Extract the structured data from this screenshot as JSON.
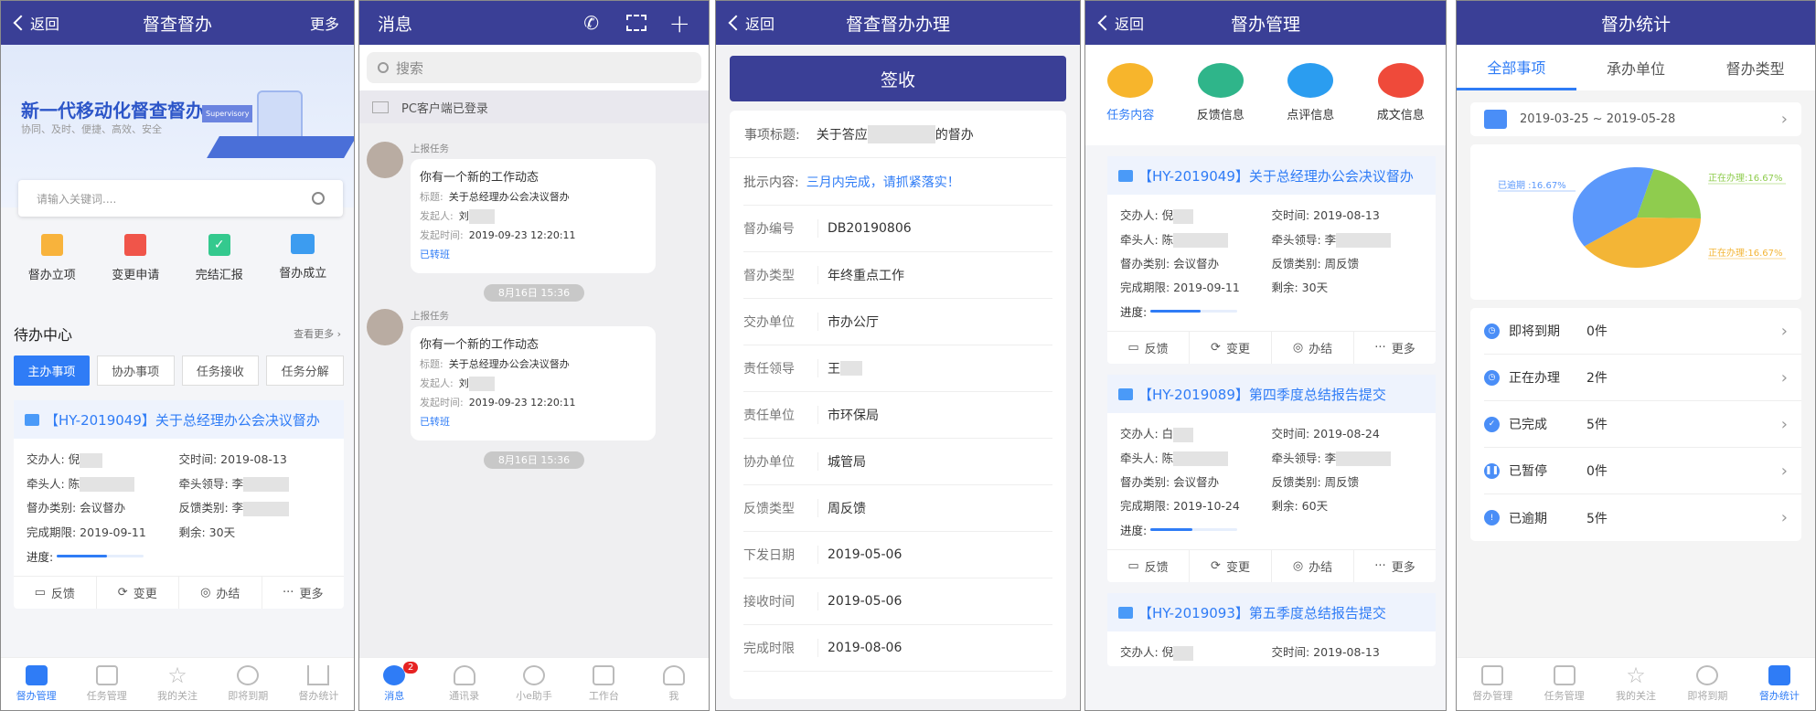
{
  "p1": {
    "back": "返回",
    "title": "督查督办",
    "more": "更多",
    "banner_title": "新一代移动化督查督办",
    "banner_sub": "协同、及时、便捷、高效、安全",
    "banner_tag": "Supervisory",
    "search_placeholder": "请输入关键词....",
    "quick": [
      {
        "label": "督办立项",
        "color": "#f8b33c"
      },
      {
        "label": "变更申请",
        "color": "#f0554a"
      },
      {
        "label": "完结汇报",
        "color": "#34c98e"
      },
      {
        "label": "督办成立",
        "color": "#3c9cf0"
      }
    ],
    "todo_title": "待办中心",
    "see_more": "查看更多",
    "tabs": [
      "主办事项",
      "协办事项",
      "任务接收",
      "任务分解"
    ],
    "card": {
      "title": "【HY-2019049】关于总经理办公会决议督办",
      "f": [
        "交办人: 倪",
        "交时间: 2019-08-13",
        "牵头人: 陈",
        "牵头领导: 李",
        "督办类别: 会议督办",
        "反馈类别: 李",
        "完成期限: 2019-09-11",
        "剩余: 30天"
      ],
      "progress_label": "进度:",
      "progress": 0.58
    },
    "actions": [
      "反馈",
      "变更",
      "办结",
      "更多"
    ],
    "nav": [
      "督办管理",
      "任务管理",
      "我的关注",
      "即将到期",
      "督办统计"
    ]
  },
  "p2": {
    "title": "消息",
    "search": "搜索",
    "pc": "PC客户端已登录",
    "msgs": [
      {
        "tag": "上报任务",
        "head": "你有一个新的工作动态",
        "t_label": "标题:",
        "t": "关于总经理办公会决议督办",
        "s_label": "发起人:",
        "s": "刘",
        "time_label": "发起时间:",
        "time": "2019-09-23  12:20:11",
        "status": "已转班",
        "stamp": "8月16日  15:36"
      },
      {
        "tag": "上报任务",
        "head": "你有一个新的工作动态",
        "t_label": "标题:",
        "t": "关于总经理办公会决议督办",
        "s_label": "发起人:",
        "s": "刘",
        "time_label": "发起时间:",
        "time": "2019-09-23  12:20:11",
        "status": "已转班",
        "stamp": "8月16日  15:36"
      }
    ],
    "nav": [
      "消息",
      "通讯录",
      "小e助手",
      "工作台",
      "我"
    ],
    "badge": "2"
  },
  "p3": {
    "back": "返回",
    "title": "督查督办办理",
    "sign": "签收",
    "subject_label": "事项标题:",
    "subject_a": "关于答应",
    "subject_b": "的督办",
    "instr_label": "批示内容:",
    "instr": "三月内完成，请抓紧落实！",
    "rows": [
      [
        "督办编号",
        "DB20190806"
      ],
      [
        "督办类型",
        "年终重点工作"
      ],
      [
        "交办单位",
        "市办公厅"
      ],
      [
        "责任领导",
        "王"
      ],
      [
        "责任单位",
        "市环保局"
      ],
      [
        "协办单位",
        "城管局"
      ],
      [
        "反馈类型",
        "周反馈"
      ],
      [
        "下发日期",
        "2019-05-06"
      ],
      [
        "接收时间",
        "2019-05-06"
      ],
      [
        "完成时限",
        "2019-08-06"
      ]
    ]
  },
  "p4": {
    "back": "返回",
    "title": "督办管理",
    "icons": [
      {
        "label": "任务内容",
        "color": "#f7b52c"
      },
      {
        "label": "反馈信息",
        "color": "#2fb58a"
      },
      {
        "label": "点评信息",
        "color": "#2b9df0"
      },
      {
        "label": "成文信息",
        "color": "#ef4a3a"
      }
    ],
    "cards": [
      {
        "title": "【HY-2019049】关于总经理办公会决议督办",
        "f": [
          "交办人: 倪",
          "交时间: 2019-08-13",
          "牵头人: 陈",
          "牵头领导: 李",
          "督办类别: 会议督办",
          "反馈类别: 周反馈",
          "完成期限: 2019-09-11",
          "剩余: 30天"
        ],
        "progress": 0.58
      },
      {
        "title": "【HY-2019089】第四季度总结报告提交",
        "f": [
          "交办人: 白",
          "交时间: 2019-08-24",
          "牵头人: 陈",
          "牵头领导: 李",
          "督办类别: 会议督办",
          "反馈类别: 周反馈",
          "完成期限: 2019-10-24",
          "剩余: 60天"
        ],
        "progress": 0.48
      },
      {
        "title": "【HY-2019093】第五季度总结报告提交",
        "f": [
          "交办人: 倪",
          "交时间: 2019-08-13"
        ]
      }
    ],
    "progress_label": "进度:",
    "actions": [
      "反馈",
      "变更",
      "办结",
      "更多"
    ]
  },
  "p5": {
    "title": "督办统计",
    "tabs": [
      "全部事项",
      "承办单位",
      "督办类型"
    ],
    "date_range": "2019-03-25 ~ 2019-05-28",
    "pie": [
      {
        "label": "正在办理:16.67%",
        "value": 0.21,
        "color": "#8fcc4e"
      },
      {
        "label": "正在办理:16.67%",
        "value": 0.4,
        "color": "#f3b536"
      },
      {
        "label": "已逾期 :16.67%",
        "value": 0.39,
        "color": "#5b98fb"
      }
    ],
    "list": [
      {
        "label": "即将到期",
        "count": "0件",
        "icon": "clock"
      },
      {
        "label": "正在办理",
        "count": "2件",
        "icon": "clock"
      },
      {
        "label": "已完成",
        "count": "5件",
        "icon": "check"
      },
      {
        "label": "已暂停",
        "count": "0件",
        "icon": "pause"
      },
      {
        "label": "已逾期",
        "count": "5件",
        "icon": "alert"
      }
    ],
    "nav": [
      "督办管理",
      "任务管理",
      "我的关注",
      "即将到期",
      "督办统计"
    ]
  }
}
